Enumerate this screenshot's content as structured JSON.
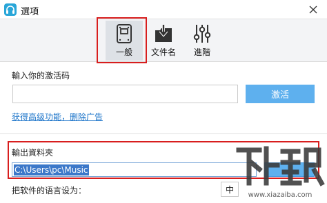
{
  "window": {
    "title": "選項",
    "icons": {
      "app": "headphones-icon",
      "close": "close-icon"
    }
  },
  "toolbar": {
    "items": [
      {
        "label": "一般",
        "icon": "general-settings-icon",
        "selected": true
      },
      {
        "label": "文件名",
        "icon": "download-file-icon",
        "selected": false
      },
      {
        "label": "進階",
        "icon": "sliders-icon",
        "selected": false
      }
    ]
  },
  "activation": {
    "label": "輸入你的激活码",
    "input_value": "",
    "button_label": "激活",
    "link_text": "获得高级功能，删除广告"
  },
  "output": {
    "label": "輸出資料夾",
    "path_value": "C:\\Users\\pc\\Music",
    "browse_label": ""
  },
  "language": {
    "label": "把软件的语言设为：",
    "selected": "中"
  },
  "watermark": {
    "brand": "下载吧",
    "url": "www.xiazaiba.com"
  },
  "colors": {
    "accent_button": "#5eb0ee",
    "highlight_box": "#d81e1e",
    "link": "#1a73c9",
    "toolbar_bg": "#f3f4f6",
    "selection": "#3c78c9"
  }
}
